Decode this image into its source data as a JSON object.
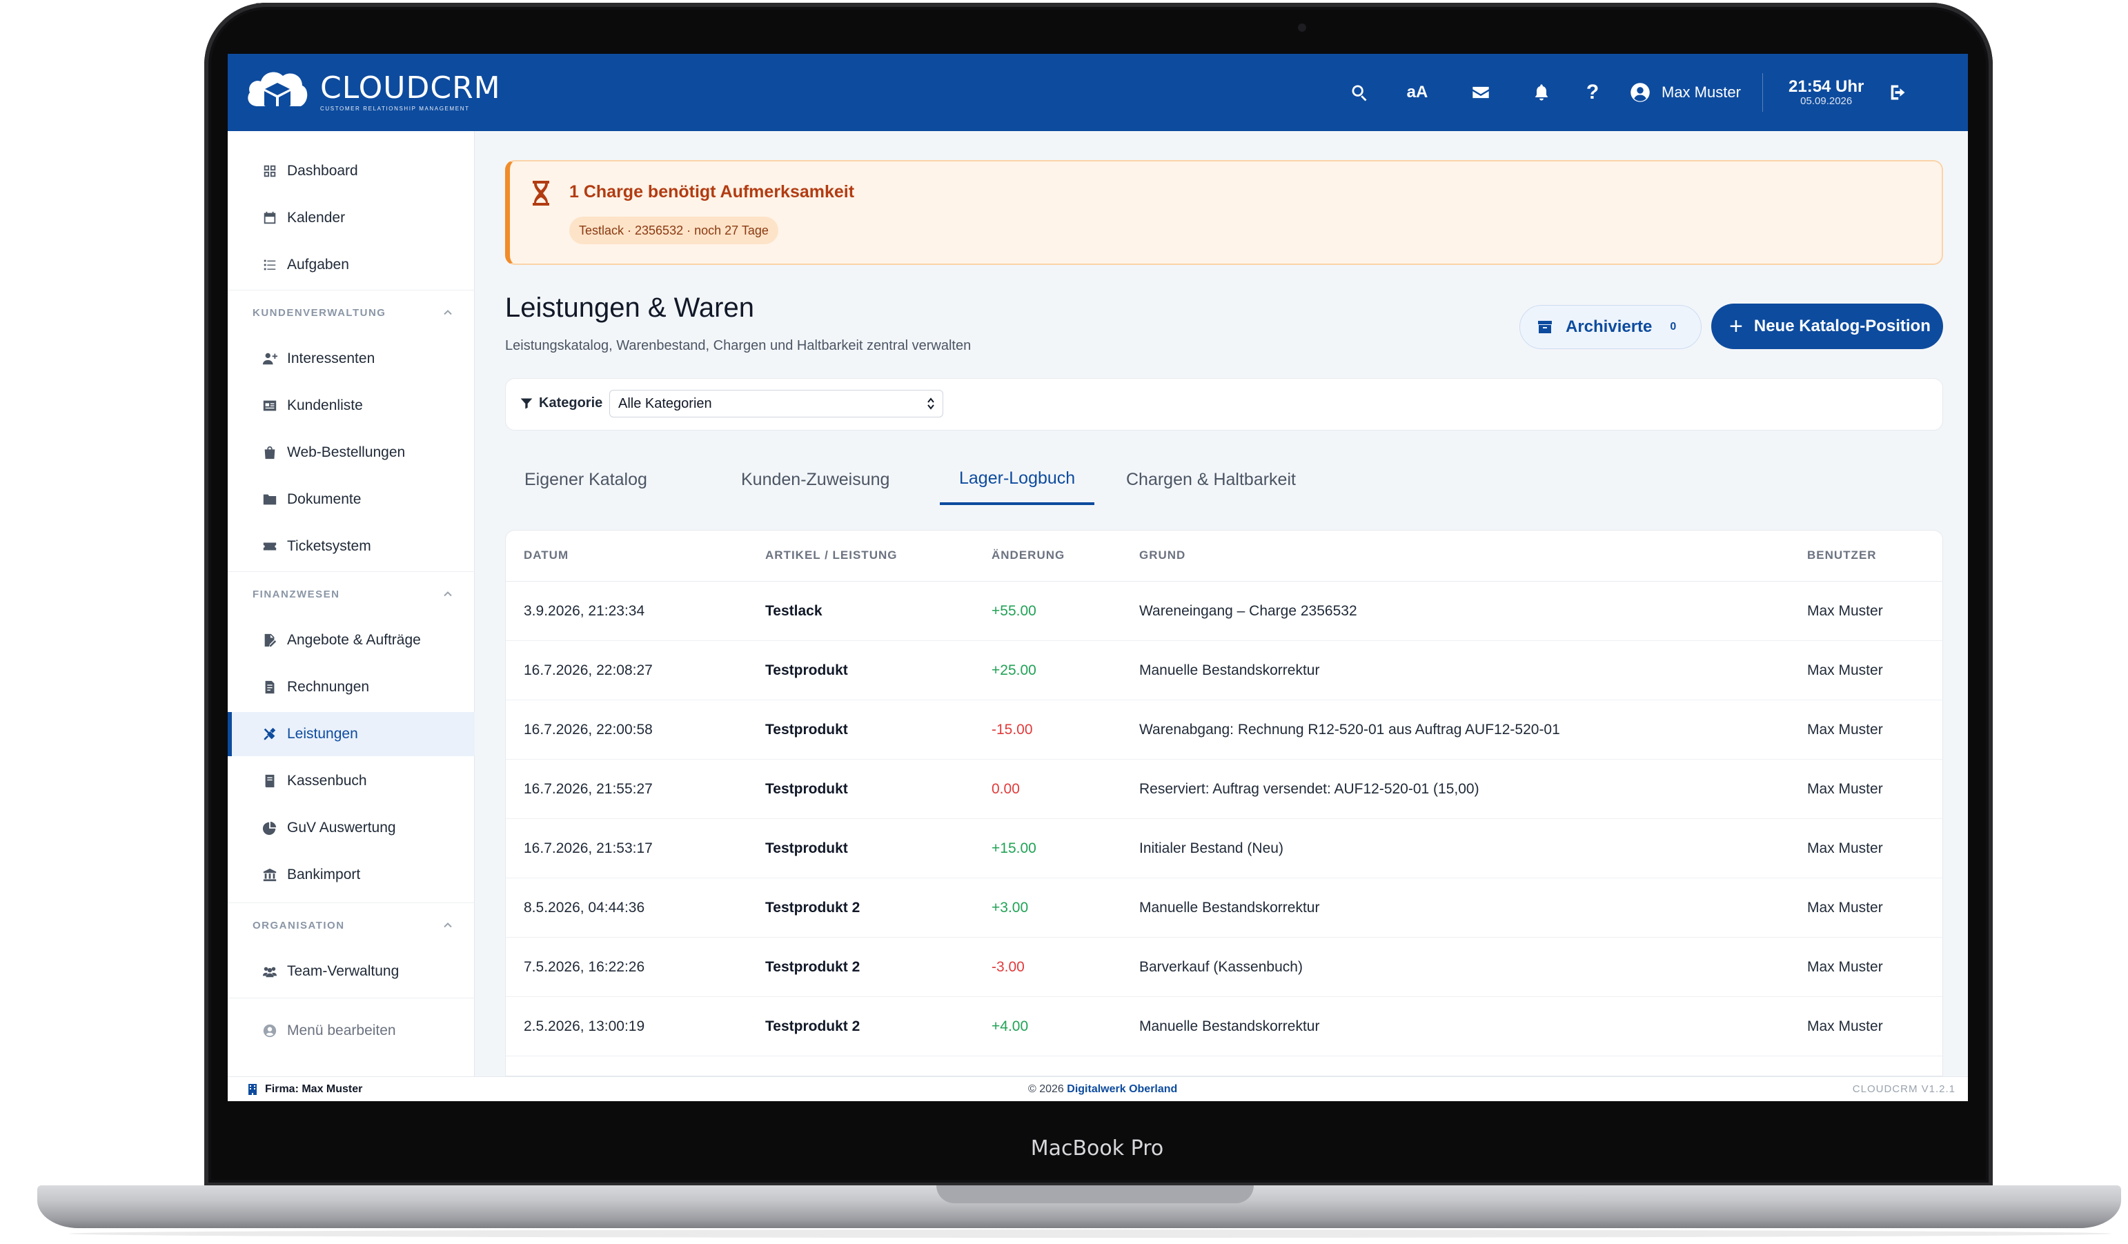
{
  "device_label": "MacBook Pro",
  "app": {
    "logo_main": "CLOUDCRM",
    "logo_sub": "CUSTOMER RELATIONSHIP MANAGEMENT",
    "brand_color": "#0d4b9e"
  },
  "topbar": {
    "icons": [
      "search-icon",
      "font-size-icon",
      "mail-icon",
      "bell-icon",
      "help-icon",
      "user-icon",
      "logout-icon"
    ],
    "font_size_label": "aA",
    "help_label": "?",
    "user_name": "Max Muster",
    "time": "21:54 Uhr",
    "date": "05.09.2026"
  },
  "sidebar": {
    "top_items": [
      {
        "label": "Dashboard",
        "icon": "grid-icon"
      },
      {
        "label": "Kalender",
        "icon": "calendar-icon"
      },
      {
        "label": "Aufgaben",
        "icon": "list-icon"
      }
    ],
    "sections": [
      {
        "title": "KUNDENVERWALTUNG",
        "items": [
          {
            "label": "Interessenten",
            "icon": "user-plus-icon"
          },
          {
            "label": "Kundenliste",
            "icon": "id-card-icon"
          },
          {
            "label": "Web-Bestellungen",
            "icon": "shopping-bag-icon"
          },
          {
            "label": "Dokumente",
            "icon": "folder-icon"
          },
          {
            "label": "Ticketsystem",
            "icon": "ticket-icon"
          }
        ]
      },
      {
        "title": "FINANZWESEN",
        "items": [
          {
            "label": "Angebote & Aufträge",
            "icon": "file-signature-icon"
          },
          {
            "label": "Rechnungen",
            "icon": "invoice-icon"
          },
          {
            "label": "Leistungen",
            "icon": "tools-icon",
            "active": true
          },
          {
            "label": "Kassenbuch",
            "icon": "book-icon"
          },
          {
            "label": "GuV Auswertung",
            "icon": "pie-chart-icon"
          },
          {
            "label": "Bankimport",
            "icon": "bank-icon"
          }
        ]
      },
      {
        "title": "ORGANISATION",
        "items": [
          {
            "label": "Team-Verwaltung",
            "icon": "users-icon"
          }
        ]
      }
    ],
    "edit_menu_label": "Menü bearbeiten"
  },
  "alert": {
    "title": "1 Charge benötigt Aufmerksamkeit",
    "chip": "Testlack · 2356532 · noch 27 Tage",
    "icon": "hourglass-icon"
  },
  "page": {
    "title": "Leistungen & Waren",
    "subtitle": "Leistungskatalog, Warenbestand, Chargen und Haltbarkeit zentral verwalten",
    "archive_label": "Archivierte",
    "archive_count": "0",
    "new_button_label": "Neue Katalog-Position"
  },
  "filter": {
    "label": "Kategorie",
    "selected": "Alle Kategorien"
  },
  "tabs": [
    {
      "label": "Eigener Katalog"
    },
    {
      "label": "Kunden-Zuweisung"
    },
    {
      "label": "Lager-Logbuch",
      "active": true
    },
    {
      "label": "Chargen & Haltbarkeit"
    }
  ],
  "table": {
    "headers": {
      "date": "DATUM",
      "item": "ARTIKEL / LEISTUNG",
      "change": "ÄNDERUNG",
      "reason": "GRUND",
      "user": "BENUTZER"
    },
    "rows": [
      {
        "date": "3.9.2026, 21:23:34",
        "item": "Testlack",
        "change": "+55.00",
        "reason": "Wareneingang – Charge 2356532",
        "user": "Max Muster"
      },
      {
        "date": "16.7.2026, 22:08:27",
        "item": "Testprodukt",
        "change": "+25.00",
        "reason": "Manuelle Bestandskorrektur",
        "user": "Max Muster"
      },
      {
        "date": "16.7.2026, 22:00:58",
        "item": "Testprodukt",
        "change": "-15.00",
        "reason": "Warenabgang: Rechnung R12-520-01 aus Auftrag AUF12-520-01",
        "user": "Max Muster"
      },
      {
        "date": "16.7.2026, 21:55:27",
        "item": "Testprodukt",
        "change": "0.00",
        "reason": "Reserviert: Auftrag versendet: AUF12-520-01 (15,00)",
        "user": "Max Muster"
      },
      {
        "date": "16.7.2026, 21:53:17",
        "item": "Testprodukt",
        "change": "+15.00",
        "reason": "Initialer Bestand (Neu)",
        "user": "Max Muster"
      },
      {
        "date": "8.5.2026, 04:44:36",
        "item": "Testprodukt 2",
        "change": "+3.00",
        "reason": "Manuelle Bestandskorrektur",
        "user": "Max Muster"
      },
      {
        "date": "7.5.2026, 16:22:26",
        "item": "Testprodukt 2",
        "change": "-3.00",
        "reason": "Barverkauf (Kassenbuch)",
        "user": "Max Muster"
      },
      {
        "date": "2.5.2026, 13:00:19",
        "item": "Testprodukt 2",
        "change": "+4.00",
        "reason": "Manuelle Bestandskorrektur",
        "user": "Max Muster"
      }
    ]
  },
  "footer": {
    "company": "Firma: Max Muster",
    "copyright": "© 2026",
    "copyright_link": "Digitalwerk Oberland",
    "version": "CLOUDCRM V1.2.1"
  }
}
